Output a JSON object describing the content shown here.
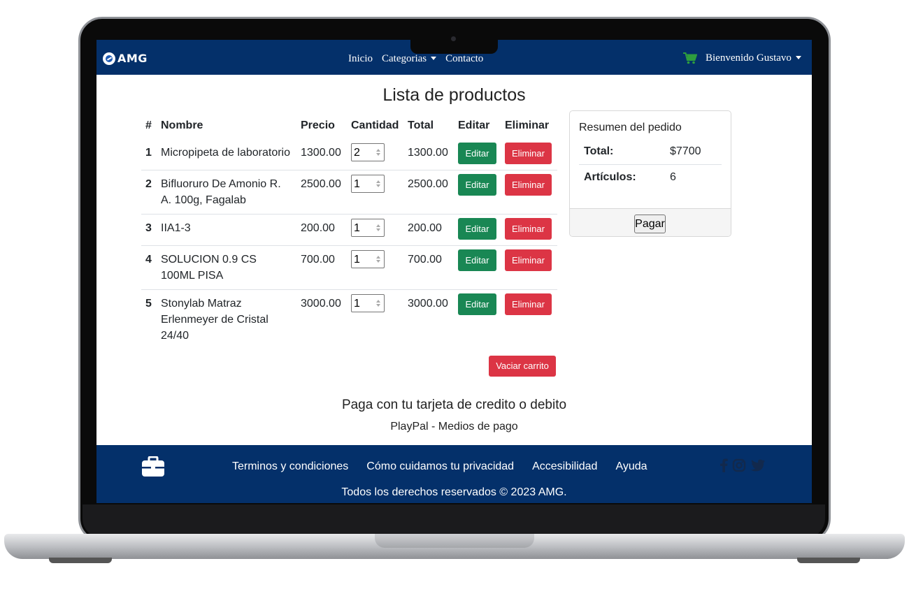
{
  "navbar": {
    "brand": "AMG",
    "links": [
      "Inicio",
      "Categorias",
      "Contacto"
    ],
    "user_greeting": "Bienvenido Gustavo"
  },
  "page": {
    "title": "Lista de productos"
  },
  "table": {
    "headers": [
      "#",
      "Nombre",
      "Precio",
      "Cantidad",
      "Total",
      "Editar",
      "Eliminar"
    ],
    "rows": [
      {
        "num": "1",
        "name": "Micropipeta de laboratorio",
        "price": "1300.00",
        "qty": "2",
        "total": "1300.00"
      },
      {
        "num": "2",
        "name": "Bifluoruro De Amonio R. A. 100g, Fagalab",
        "price": "2500.00",
        "qty": "1",
        "total": "2500.00"
      },
      {
        "num": "3",
        "name": "IIA1-3",
        "price": "200.00",
        "qty": "1",
        "total": "200.00"
      },
      {
        "num": "4",
        "name": "SOLUCION 0.9 CS 100ML PISA",
        "price": "700.00",
        "qty": "1",
        "total": "700.00"
      },
      {
        "num": "5",
        "name": "Stonylab Matraz Erlenmeyer de Cristal 24/40",
        "price": "3000.00",
        "qty": "1",
        "total": "3000.00"
      }
    ],
    "edit_label": "Editar",
    "delete_label": "Eliminar",
    "empty_cart_label": "Vaciar carrito"
  },
  "summary": {
    "title": "Resumen del pedido",
    "total_label": "Total:",
    "total_value": "$7700",
    "items_label": "Artículos:",
    "items_value": "6",
    "pay_label": "Pagar"
  },
  "payment": {
    "heading": "Paga con tu tarjeta de credito o debito",
    "subtext": "PlayPal - Medios de pago"
  },
  "footer": {
    "links": [
      "Terminos y condiciones",
      "Cómo cuidamos tu privacidad",
      "Accesibilidad",
      "Ayuda"
    ],
    "copyright": "Todos los derechos reservados © 2023 AMG."
  },
  "colors": {
    "navy": "#04306a",
    "success": "#198754",
    "danger": "#dc3545",
    "cart_icon": "#2e9e3e"
  },
  "icons": [
    "globe-logo-icon",
    "chevron-down-icon",
    "shopping-cart-icon",
    "briefcase-icon",
    "facebook-icon",
    "instagram-icon",
    "twitter-icon"
  ]
}
